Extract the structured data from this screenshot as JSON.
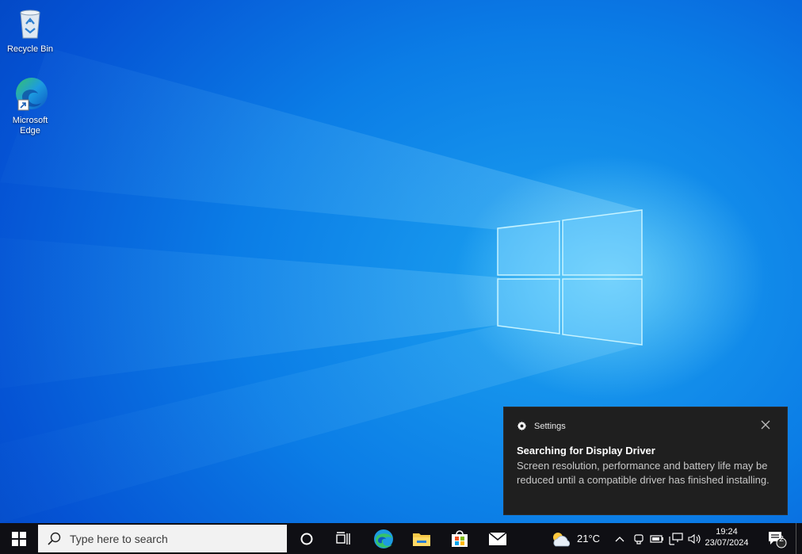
{
  "desktop": {
    "icons": [
      {
        "label": "Recycle Bin",
        "icon": "recycle-bin-icon"
      },
      {
        "label": "Microsoft Edge",
        "icon": "edge-icon"
      }
    ]
  },
  "toast": {
    "app": "Settings",
    "app_icon": "gear-icon",
    "title": "Searching for Display Driver",
    "body": "Screen resolution, performance and battery life may be reduced until a compatible driver has finished installing."
  },
  "taskbar": {
    "search_placeholder": "Type here to search",
    "pinned": [
      "cortana-icon",
      "task-view-icon",
      "edge-icon",
      "file-explorer-icon",
      "store-icon",
      "mail-icon"
    ],
    "weather": {
      "temperature": "21°C",
      "icon": "partly-cloudy-icon"
    },
    "tray_icons": [
      "chevron-up-icon",
      "meet-now-icon",
      "battery-icon",
      "network-icon",
      "volume-icon"
    ],
    "clock": {
      "time": "19:24",
      "date": "23/07/2024"
    },
    "notifications": {
      "count": "2",
      "icon": "action-center-icon"
    }
  },
  "colors": {
    "desktop_blue": "#0b7de6",
    "taskbar": "#0f0f14",
    "toast_bg": "#1f1f1f"
  }
}
